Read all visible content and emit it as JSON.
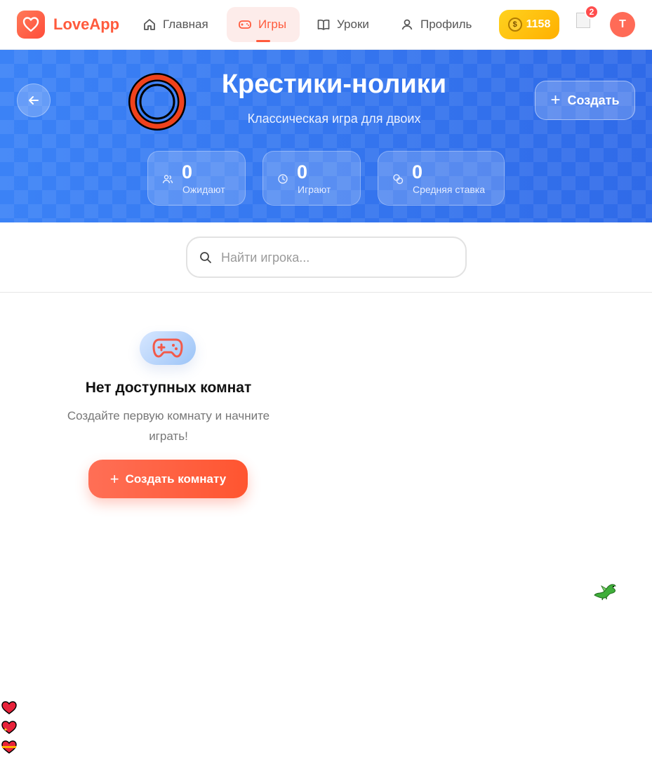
{
  "brand": {
    "name": "LoveApp",
    "accent": "#ff5a3c"
  },
  "nav": {
    "items": [
      {
        "label": "Главная",
        "icon": "home-icon"
      },
      {
        "label": "Игры",
        "icon": "gamepad-icon",
        "active": true
      },
      {
        "label": "Уроки",
        "icon": "book-icon"
      },
      {
        "label": "Профиль",
        "icon": "user-icon"
      }
    ]
  },
  "header": {
    "coins": "1158",
    "notifications": "2",
    "avatar_initial": "T"
  },
  "hero": {
    "title": "Крестики-нолики",
    "subtitle": "Классическая игра для двоих",
    "create_label": "Создать",
    "stats": [
      {
        "value": "0",
        "label": "Ожидают",
        "icon": "users-icon"
      },
      {
        "value": "0",
        "label": "Играют",
        "icon": "clock-icon"
      },
      {
        "value": "0",
        "label": "Средняя ставка",
        "icon": "coins-icon"
      }
    ]
  },
  "search": {
    "placeholder": "Найти игрока...",
    "value": ""
  },
  "empty": {
    "title": "Нет доступных комнат",
    "description": "Создайте первую комнату и начните играть!",
    "button_label": "Создать комнату"
  }
}
